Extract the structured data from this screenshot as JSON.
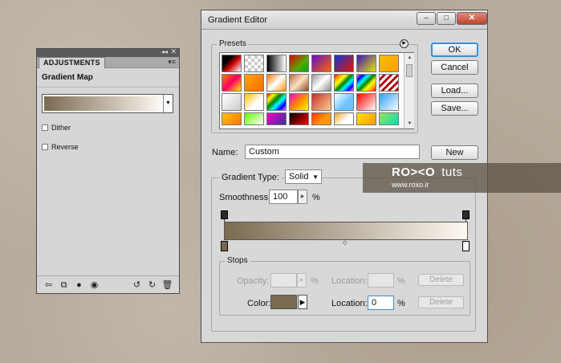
{
  "adjustments": {
    "tab_label": "ADJUSTMENTS",
    "panel_title": "Gradient Map",
    "gradient": {
      "start_color": "#7a6a50",
      "end_color": "#fdf8f1"
    },
    "dither_label": "Dither",
    "reverse_label": "Reverse",
    "bottom_icons": [
      "return-arrow-icon",
      "clip-layer-icon",
      "visibility-icon",
      "view-previous-icon",
      "reset-icon",
      "redraw-icon",
      "delete-icon"
    ]
  },
  "editor": {
    "title": "Gradient Editor",
    "presets_label": "Presets",
    "buttons": {
      "ok": "OK",
      "cancel": "Cancel",
      "load": "Load...",
      "save": "Save...",
      "new": "New"
    },
    "name_label": "Name:",
    "name_value": "Custom",
    "gradient_type_label": "Gradient Type:",
    "gradient_type_value": "Solid",
    "smoothness_label": "Smoothness:",
    "smoothness_value": "100",
    "percent": "%",
    "stops_label": "Stops",
    "opacity_label": "Opacity:",
    "location_label": "Location:",
    "color_label": "Color:",
    "color_location_value": "0",
    "delete_label": "Delete",
    "gradient": {
      "start_color": "#7a6a50",
      "end_color": "#fdf8f1"
    }
  },
  "presets": [
    "linear-gradient(135deg,#000,#000 30%,#c00 55%,#fff)",
    "repeating-conic-gradient(#ccc 0 25%,#fff 0 50%) 0 0/8px 8px",
    "linear-gradient(to right,#000,#fff)",
    "linear-gradient(135deg,#d00,#5a0 60%,#0a0)",
    "linear-gradient(135deg,#610fc6,#f60)",
    "linear-gradient(135deg,#0c38d1,#e81400)",
    "linear-gradient(135deg,#3a14c1,#e9e300)",
    "linear-gradient(135deg,#f0c000,#ff9c00)",
    "linear-gradient(135deg,#ff7a00,#ff0062 50%,#ffe900)",
    "linear-gradient(135deg,#ffa500,#ff6a00)",
    "linear-gradient(135deg,#ff7800,#fff 50%,#ff9400)",
    "linear-gradient(135deg,#b86e48,#ffe0c2 50%,#8a4a26)",
    "linear-gradient(135deg,#999,#fff 50%,#888)",
    "linear-gradient(135deg,red,orange,yellow,green,cyan,blue,violet)",
    "linear-gradient(135deg,violet,blue,cyan,green,yellow,orange,red)",
    "repeating-linear-gradient(135deg,#fff 0 3px,#a00 3px 6px)",
    "linear-gradient(135deg,#fff,#ccc)",
    "linear-gradient(135deg,#f7c100,#fff 60%)",
    "linear-gradient(135deg,red,yellow,green,cyan,blue,violet)",
    "linear-gradient(135deg,#ff00d2,#ff8a00,#fff700)",
    "linear-gradient(135deg,#c42d2d,#ffd08f)",
    "linear-gradient(135deg,#ffffff,#6ec3ff 60%)",
    "linear-gradient(135deg,#ff0000,#ffffff)",
    "linear-gradient(135deg,#2ba2f5,#fff)",
    "linear-gradient(135deg,#ffc500,#ff7300)",
    "linear-gradient(135deg,#66ff00,#ffffff)",
    "linear-gradient(135deg,#ff00cc,#333399)",
    "linear-gradient(135deg,#000,#ff0000)",
    "linear-gradient(135deg,#ff3300,#ff9900 60%)",
    "linear-gradient(135deg,#f5a623,#fff 60%)",
    "linear-gradient(135deg,#ffe100,#ff9900)",
    "linear-gradient(135deg,#9be15d,#00e3ae)",
    "linear-gradient(135deg,#333,#aaa)",
    "linear-gradient(135deg,#ff6600,#ffcc00)",
    "linear-gradient(135deg,#d40000,#660000)",
    "linear-gradient(135deg,#ff9900,#cc3300)",
    "linear-gradient(135deg,#ffff66,#ffcc00)",
    "linear-gradient(135deg,#ffd700,#fffacd)",
    "linear-gradient(135deg,#d0a000,#d0a000 40%,#7fbf00)",
    "linear-gradient(135deg,#aaa,#ddd)"
  ],
  "watermark": {
    "brand": "RO><O",
    "suffix": "tuts",
    "url": "www.roxo.ir"
  }
}
